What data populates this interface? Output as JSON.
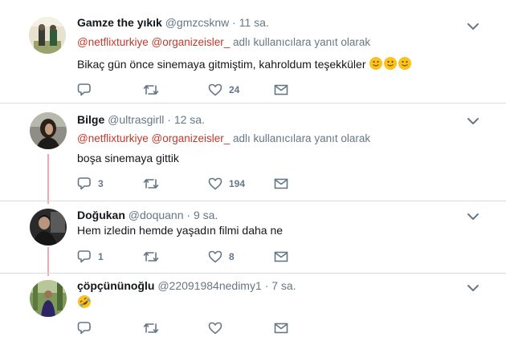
{
  "tweets": [
    {
      "name": "Gamze the yıkık",
      "handle": "@gmzcsknw",
      "dot": "·",
      "time": "11 sa.",
      "reply_mentions": [
        "@netflixturkiye",
        "@organizeisler_"
      ],
      "reply_suffix": "adlı kullanıcılara yanıt olarak",
      "text": "Bikaç gün önce sinemaya gitmiştim, kahroldum teşekküler",
      "text_emoji": "slightly-smiling-face x3",
      "reply_count": "",
      "retweet_count": "",
      "like_count": "24"
    },
    {
      "name": "Bilge",
      "handle": "@ultrasgirll",
      "dot": "·",
      "time": "12 sa.",
      "reply_mentions": [
        "@netflixturkiye",
        "@organizeisler_"
      ],
      "reply_suffix": "adlı kullanıcılara yanıt olarak",
      "text": "boşa sinemaya gittik",
      "reply_count": "3",
      "retweet_count": "",
      "like_count": "194"
    },
    {
      "name": "Doğukan",
      "handle": "@doquann",
      "dot": "·",
      "time": "9 sa.",
      "text": "Hem izledin hemde yaşadın filmi daha ne",
      "reply_count": "1",
      "retweet_count": "",
      "like_count": "8"
    },
    {
      "name": "çöpçününoğlu",
      "handle": "@22091984nedimy1",
      "dot": "·",
      "time": "7 sa.",
      "text_emoji": "rolling-on-floor-laughing",
      "reply_count": "",
      "retweet_count": "",
      "like_count": ""
    }
  ],
  "icons": {
    "reply": "reply-icon",
    "retweet": "retweet-icon",
    "like": "heart-icon",
    "dm": "envelope-icon",
    "caret": "chevron-down-icon"
  },
  "colors": {
    "mention": "#c0392b",
    "thread_line": "#f6a7ae",
    "muted": "#657786",
    "text": "#14171a"
  }
}
